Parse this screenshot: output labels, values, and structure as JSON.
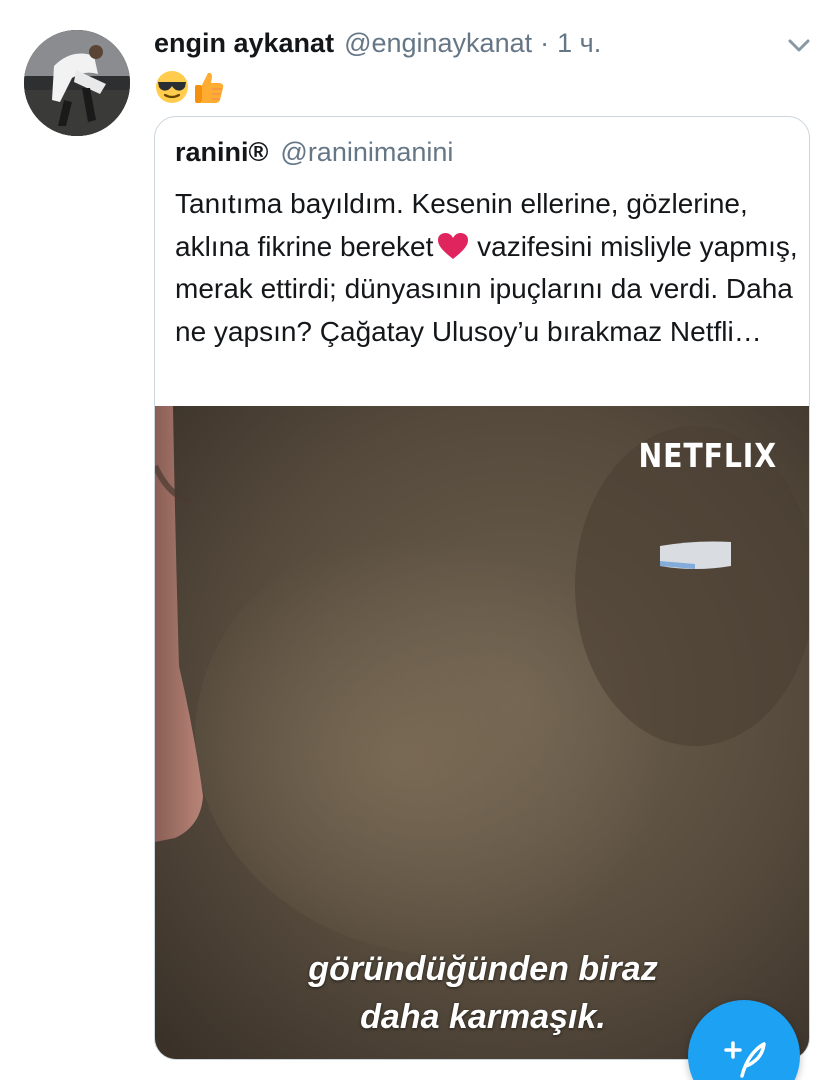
{
  "tweet": {
    "author_name": "engin aykanat",
    "author_handle": "@enginaykanat",
    "separator": "·",
    "time": "1 ч.",
    "emojis": [
      "sunglasses-face",
      "thumbs-up"
    ]
  },
  "quoted_tweet": {
    "author_name": "ranini®",
    "author_handle": "@raninimanini",
    "text_before_heart": "Tanıtıma bayıldım. Kesenin ellerine, gözlerine, aklına fikrine bereket",
    "text_after_heart": "vazifesini misliyle yapmış, merak ettirdi; dünyasının ipuçlarını da verdi. Daha ne yapsın? Çağatay Ulusoy’u bırakmaz Netfli…",
    "media": {
      "watermark": "NETFLIX",
      "subtitle_line1": "göründüğünden biraz",
      "subtitle_line2": "daha karmaşık."
    }
  },
  "colors": {
    "accent": "#1da1f2",
    "secondary_text": "#657786",
    "border": "#ccd6dd",
    "heart": "#e0245e"
  }
}
